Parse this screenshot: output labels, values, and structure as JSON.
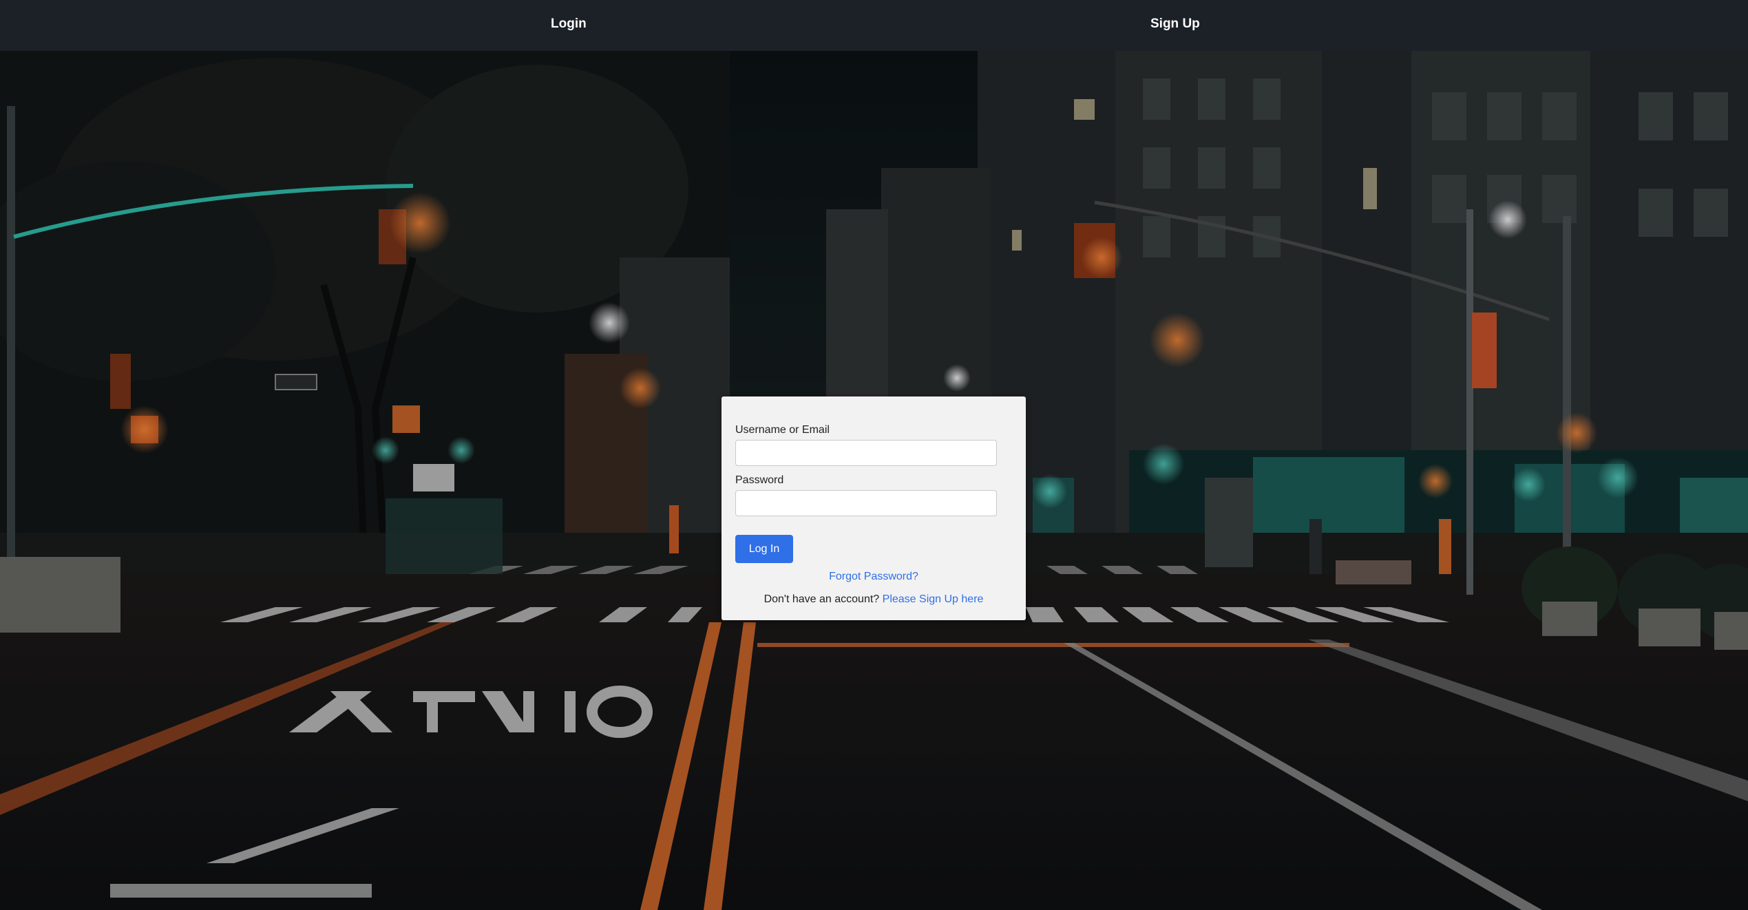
{
  "nav": {
    "login_label": "Login",
    "signup_label": "Sign Up"
  },
  "login_form": {
    "username_label": "Username or Email",
    "username_value": "",
    "password_label": "Password",
    "password_value": "",
    "submit_label": "Log In",
    "forgot_link": "Forgot Password?",
    "no_account_text": "Don't have an account?",
    "signup_link": "Please Sign Up here"
  },
  "colors": {
    "navbar_bg": "#1c2128",
    "card_bg": "#f2f2f2",
    "accent": "#2f6fe8"
  }
}
